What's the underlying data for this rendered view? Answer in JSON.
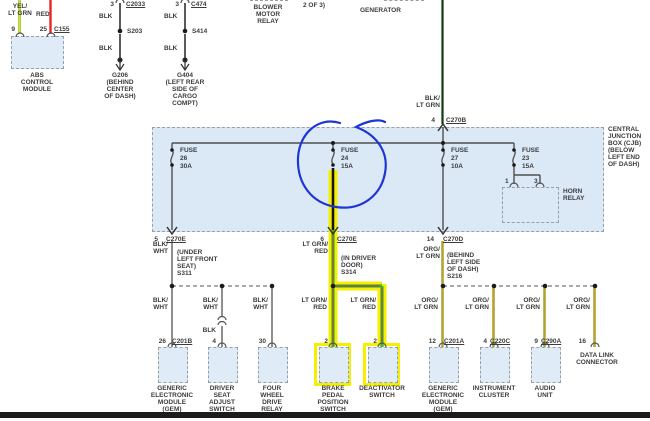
{
  "abs": {
    "wire_left": "YEL/\nLT GRN",
    "wire_right": "RED",
    "pin_left": "9",
    "pin_right": "25",
    "connector": "C155",
    "name": "ABS\nCONTROL\nMODULE"
  },
  "ground_left": {
    "pin": "3",
    "connector": "C2033",
    "wire_top": "BLK",
    "splice": "S203",
    "wire_bottom": "BLK",
    "ground": "G206\n(BEHIND\nCENTER\nOF DASH)"
  },
  "ground_right": {
    "pin": "3",
    "connector": "C474",
    "wire_top": "BLK",
    "splice": "S414",
    "wire_bottom": "BLK",
    "ground": "G404\n(LEFT REAR\nSIDE OF\nCARGO\nCOMPT)"
  },
  "top": {
    "blower": "BLOWER\nMOTOR\nRELAY",
    "partial": "2 OF 3)",
    "generator": "GENERATOR"
  },
  "feed": {
    "wire": "BLK/\nLT GRN",
    "pin": "4",
    "connector": "C270B"
  },
  "cjb": {
    "title": "CENTRAL\nJUNCTION\nBOX (CJB)\n(BELOW\nLEFT END\nOF DASH)",
    "fuses": [
      {
        "name": "FUSE",
        "number": "26",
        "amps": "30A"
      },
      {
        "name": "FUSE",
        "number": "24",
        "amps": "15A"
      },
      {
        "name": "FUSE",
        "number": "27",
        "amps": "10A"
      },
      {
        "name": "FUSE",
        "number": "23",
        "amps": "15A"
      }
    ],
    "horn": {
      "label": "HORN\nRELAY",
      "pin_left": "1",
      "pin_right": "3"
    }
  },
  "exits": [
    {
      "pin": "5",
      "connector": "C270E",
      "wire": "BLK/\nWHT",
      "note": "(UNDER\nLEFT FRONT\nSEAT)\nS311"
    },
    {
      "pin": "6",
      "connector": "C270E",
      "wire": "LT GRN/\nRED",
      "note": "(IN DRIVER\nDOOR)\nS314"
    },
    {
      "pin": "14",
      "connector": "C270D",
      "wire": "ORG/\nLT GRN",
      "note": "(BEHIND\nLEFT SIDE\nOF DASH)\nS216"
    }
  ],
  "columns": [
    {
      "wire": "BLK/\nWHT",
      "pin": "26",
      "connector": "C201B",
      "component": "GENERIC\nELECTRONIC\nMODULE\n(GEM)"
    },
    {
      "wire": "BLK/\nWHT",
      "inline_wire": "BLK",
      "pin": "4",
      "component": "DRIVER\nSEAT\nADJUST\nSWITCH"
    },
    {
      "wire": "BLK/\nWHT",
      "pin": "30",
      "component": "FOUR\nWHEEL\nDRIVE\nRELAY"
    },
    {
      "wire": "LT GRN/\nRED",
      "pin": "2",
      "component": "BRAKE\nPEDAL\nPOSITION\nSWITCH"
    },
    {
      "wire": "LT GRN/\nRED",
      "pin": "2",
      "component": "DEACTIVATOR\nSWITCH"
    },
    {
      "wire": "ORG/\nLT GRN",
      "pin": "12",
      "connector": "C201A",
      "component": "GENERIC\nELECTRONIC\nMODULE\n(GEM)"
    },
    {
      "wire": "ORG/\nLT GRN",
      "pin": "4",
      "connector": "C220C",
      "component": "INSTRUMENT\nCLUSTER"
    },
    {
      "wire": "ORG/\nLT GRN",
      "pin": "9",
      "connector": "C290A",
      "component": "AUDIO\nUNIT"
    },
    {
      "wire": "ORG/\nLT GRN",
      "pin": "16",
      "component": "DATA LINK\nCONNECTOR"
    }
  ],
  "annotation": {
    "shape": "hand-drawn circle around Fuse 24",
    "color": "#1f35d4"
  },
  "highlight_color": "#f7ef00"
}
